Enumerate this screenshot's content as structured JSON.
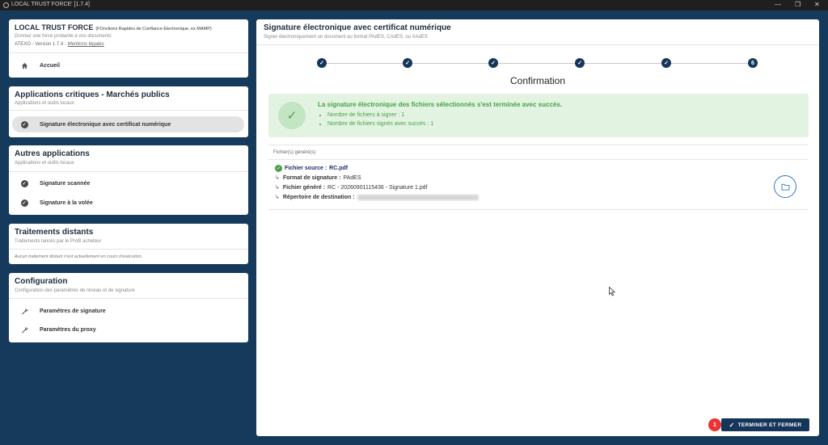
{
  "window": {
    "title": "LOCAL TRUST FORCE' [1.7.4]"
  },
  "header_card": {
    "app_name": "LOCAL TRUST FORCE",
    "app_subtitle": "(FOnctions Rapides de Confiance Electronique, ex MAMP)",
    "tagline": "Donnez une force probante à vos documents",
    "version": "ATEXO - Version 1.7.4 -",
    "legal_link": "Mentions légales",
    "home": {
      "label": "Accueil",
      "icon": "home-icon"
    }
  },
  "critical_apps": {
    "title": "Applications critiques - Marchés publics",
    "subtitle": "Applications et outils locaux",
    "items": [
      {
        "label": "Signature électronique avec certificat numérique",
        "icon": "check-circle-icon",
        "selected": true
      }
    ]
  },
  "other_apps": {
    "title": "Autres applications",
    "subtitle": "Applications et outils locaux",
    "items": [
      {
        "label": "Signature scannée",
        "icon": "check-circle-icon"
      },
      {
        "label": "Signature à la volée",
        "icon": "check-circle-icon"
      }
    ]
  },
  "remote": {
    "title": "Traitements distants",
    "subtitle": "Traitements lancés par le Profil acheteur",
    "empty_text": "Aucun traitement distant n'est actuellement en cours d'exécution."
  },
  "config": {
    "title": "Configuration",
    "subtitle": "Configuration des paramètres de réseau et de signature",
    "items": [
      {
        "label": "Paramètres de signature",
        "icon": "wrench-icon"
      },
      {
        "label": "Paramètres du proxy",
        "icon": "wrench-icon"
      }
    ]
  },
  "main": {
    "title": "Signature électronique avec certificat numérique",
    "subtitle": "Signer électroniquement un document au format PAdES, CAdES, ou XAdES",
    "steps": [
      "✓",
      "✓",
      "✓",
      "✓",
      "✓",
      "6"
    ],
    "current_step_title": "Confirmation",
    "success": {
      "title": "La signature électronique des fichiers sélectionnés s'est terminée avec succès.",
      "items": [
        "Nombre de fichiers à signer : 1",
        "Nombre de fichiers signés avec succès : 1"
      ]
    },
    "files_header": "Fichier(s) généré(s)",
    "source_label": "Fichier source :",
    "source_value": "RC.pdf",
    "format_label": "Format de signature :",
    "format_value": "PAdES",
    "generated_label": "Fichier généré :",
    "generated_value": "RC - 20260901115436 - Signature 1.pdf",
    "dest_label": "Répertoire de destination :",
    "finish_button": "TERMINER ET FERMER",
    "badge": "1"
  },
  "colors": {
    "navy": "#15365a",
    "success": "#45a245",
    "background": "#163a5c"
  }
}
